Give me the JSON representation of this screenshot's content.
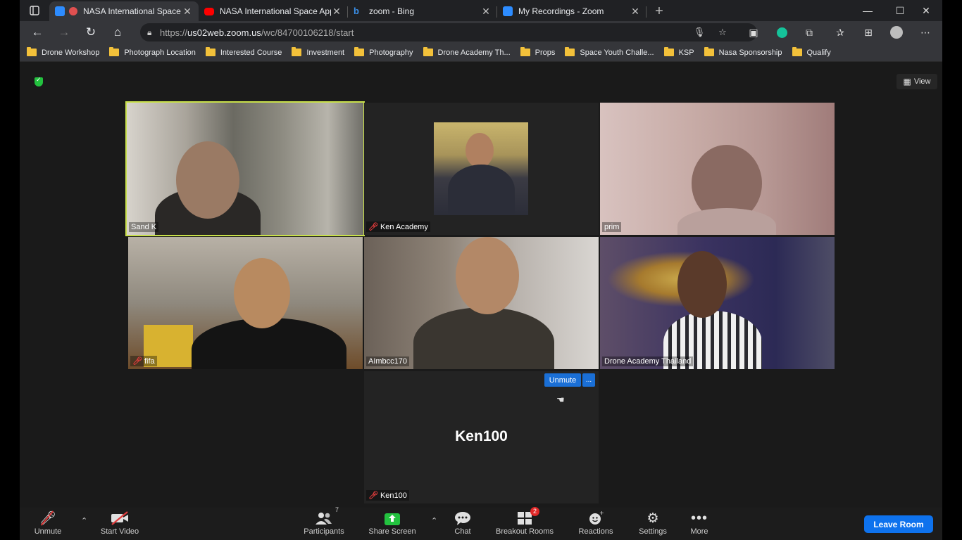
{
  "browser": {
    "tabs": [
      {
        "title": "NASA International Space A",
        "active": true,
        "icon": "zoom-recording-icon"
      },
      {
        "title": "NASA International Space App T",
        "active": false,
        "icon": "youtube-icon"
      },
      {
        "title": "zoom - Bing",
        "active": false,
        "icon": "bing-icon"
      },
      {
        "title": "My Recordings - Zoom",
        "active": false,
        "icon": "zoom-icon"
      }
    ],
    "url_prefix": "https://",
    "url_host": "us02web.zoom.us",
    "url_path": "/wc/84700106218/start",
    "bookmarks": [
      "Drone Workshop",
      "Photograph Location",
      "Interested Course",
      "Investment",
      "Photography",
      "Drone Academy Th...",
      "Props",
      "Space Youth Challe...",
      "KSP",
      "Nasa Sponsorship",
      "Qualify"
    ]
  },
  "meeting": {
    "view_label": "View",
    "participants_tiles": [
      {
        "name": "Sand K",
        "muted": false,
        "speaking": true
      },
      {
        "name": "Ken Academy",
        "muted": true,
        "speaking": false
      },
      {
        "name": "prim",
        "muted": false,
        "speaking": false
      },
      {
        "name": "fifa",
        "muted": true,
        "speaking": false
      },
      {
        "name": "AImbcc170",
        "muted": false,
        "speaking": false
      },
      {
        "name": "Drone Academy Thailand",
        "muted": false,
        "speaking": false
      },
      {
        "name": "Ken100",
        "muted": true,
        "speaking": false
      }
    ],
    "ken100_big_name": "Ken100",
    "unmute_button": "Unmute",
    "more_button": "..."
  },
  "toolbar": {
    "unmute": "Unmute",
    "start_video": "Start Video",
    "participants": "Participants",
    "participants_count": "7",
    "share_screen": "Share Screen",
    "chat": "Chat",
    "breakout_rooms": "Breakout Rooms",
    "breakout_badge": "2",
    "reactions": "Reactions",
    "settings": "Settings",
    "more": "More",
    "leave_room": "Leave Room"
  },
  "colors": {
    "accent_blue": "#0e72ed",
    "speaking_border": "#c8e04a",
    "mute_red": "#e03c3c",
    "share_green": "#23c23f"
  }
}
